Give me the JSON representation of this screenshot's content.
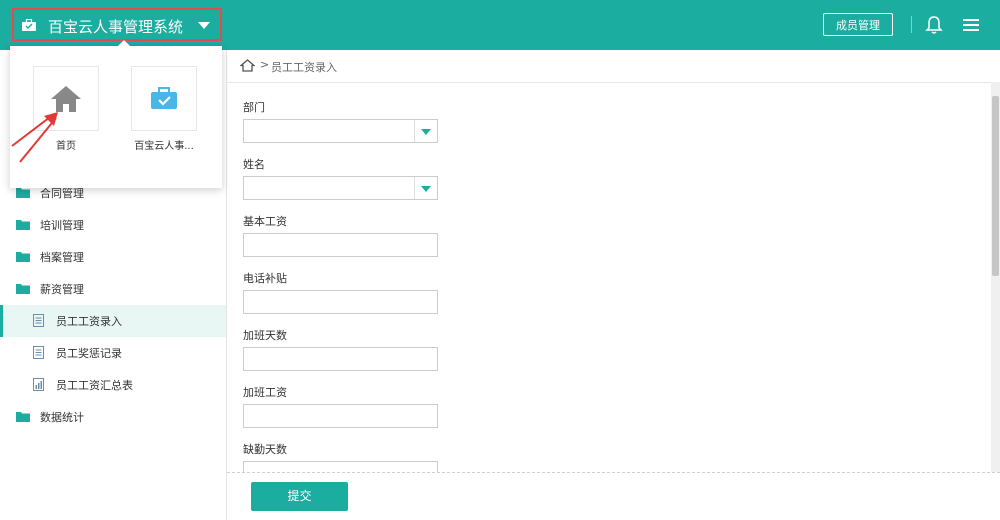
{
  "header": {
    "app_title": "百宝云人事管理系统",
    "member_button": "成员管理"
  },
  "app_popup": {
    "apps": [
      {
        "label": "首页",
        "icon": "home-icon"
      },
      {
        "label": "百宝云人事...",
        "icon": "briefcase-icon"
      }
    ]
  },
  "sidebar": {
    "items": [
      {
        "label": "合同管理",
        "icon": "folder-icon"
      },
      {
        "label": "培训管理",
        "icon": "folder-icon"
      },
      {
        "label": "档案管理",
        "icon": "folder-icon"
      },
      {
        "label": "薪资管理",
        "icon": "folder-icon"
      },
      {
        "label": "员工工资录入",
        "icon": "document-icon",
        "active": true
      },
      {
        "label": "员工奖惩记录",
        "icon": "document-icon"
      },
      {
        "label": "员工工资汇总表",
        "icon": "report-icon"
      },
      {
        "label": "数据统计",
        "icon": "folder-icon"
      }
    ]
  },
  "breadcrumb": {
    "separator": ">",
    "current": "员工工资录入"
  },
  "form": {
    "fields": [
      {
        "label": "部门",
        "type": "dropdown",
        "value": ""
      },
      {
        "label": "姓名",
        "type": "dropdown",
        "value": ""
      },
      {
        "label": "基本工资",
        "type": "text",
        "value": ""
      },
      {
        "label": "电话补贴",
        "type": "text",
        "value": ""
      },
      {
        "label": "加班天数",
        "type": "text",
        "value": ""
      },
      {
        "label": "加班工资",
        "type": "text",
        "value": ""
      },
      {
        "label": "缺勤天数",
        "type": "text",
        "value": ""
      }
    ],
    "submit_label": "提交"
  },
  "colors": {
    "primary": "#1aada0",
    "highlight_box": "#e24c4c"
  }
}
